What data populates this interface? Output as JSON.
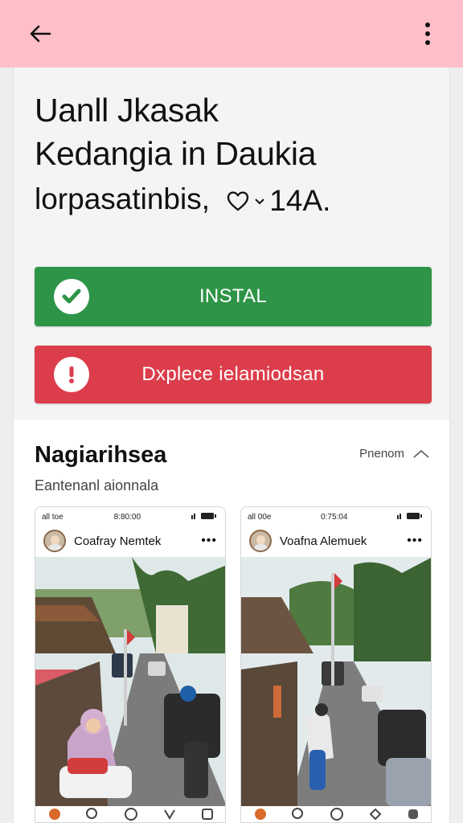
{
  "topbar": {
    "back_icon": "arrow-left-icon",
    "menu_icon": "more-vert-icon"
  },
  "app": {
    "title_line1": "Uanll Jkasak",
    "title_line2": "Kedangia in Daukia",
    "subtitle": "lorpasatinbis,",
    "subtitle_count": "14A."
  },
  "buttons": {
    "install_label": "INSTAL",
    "danger_label": "Dxplece ielamiodsan"
  },
  "section": {
    "title": "Nagiarihsea",
    "more_label": "Pnenom",
    "subtitle": "Eantenanl aionnala"
  },
  "screenshots": [
    {
      "status_left": "all toe",
      "status_center": "8:80:00",
      "author": "Coafray Nemtek"
    },
    {
      "status_left": "all 00e",
      "status_center": "0:75:04",
      "author": "Voafna Alemuek"
    }
  ],
  "colors": {
    "topbar": "#ffbfc9",
    "install": "#2e9447",
    "danger": "#dc3d4b"
  }
}
